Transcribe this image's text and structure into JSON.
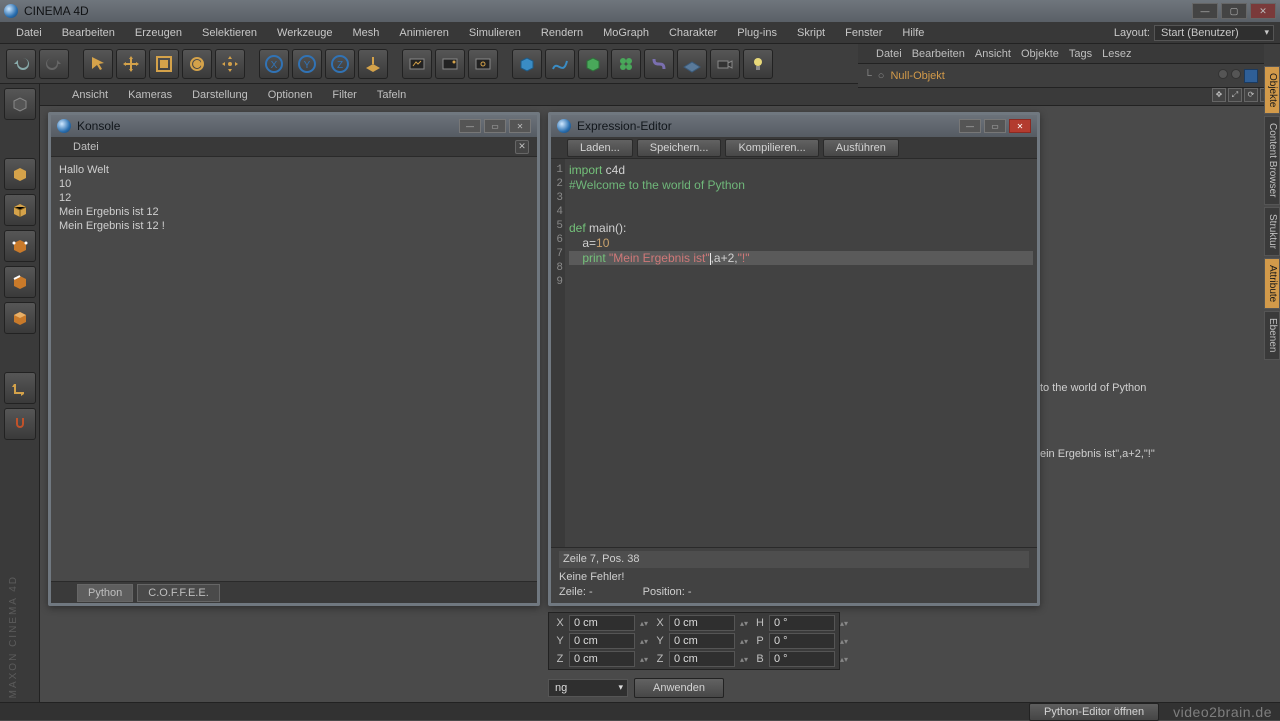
{
  "app": {
    "title": "CINEMA 4D"
  },
  "menubar": [
    "Datei",
    "Bearbeiten",
    "Erzeugen",
    "Selektieren",
    "Werkzeuge",
    "Mesh",
    "Animieren",
    "Simulieren",
    "Rendern",
    "MoGraph",
    "Charakter",
    "Plug-ins",
    "Skript",
    "Fenster",
    "Hilfe"
  ],
  "layout": {
    "label": "Layout:",
    "value": "Start (Benutzer)"
  },
  "viewport_menu": [
    "Ansicht",
    "Kameras",
    "Darstellung",
    "Optionen",
    "Filter",
    "Tafeln"
  ],
  "konsole": {
    "title": "Konsole",
    "menu": "Datei",
    "lines": [
      "Hallo Welt",
      "10",
      "12",
      "Mein Ergebnis ist 12",
      "Mein Ergebnis ist 12 !"
    ],
    "tabs": {
      "python": "Python",
      "coffee": "C.O.F.F.E.E."
    }
  },
  "expr": {
    "title": "Expression-Editor",
    "buttons": {
      "load": "Laden...",
      "save": "Speichern...",
      "compile": "Kompilieren...",
      "run": "Ausführen"
    },
    "code": {
      "l1_kw": "import",
      "l1_rest": " c4d",
      "l2": "#Welcome to the world of Python",
      "l5_kw": "def",
      "l5_rest": " main():",
      "l6_pre": "    a=",
      "l6_num": "10",
      "l7_pre": "    ",
      "l7_kw": "print",
      "l7_sp": " ",
      "l7_str1": "\"Mein Ergebnis ist\"",
      "l7_mid": ",a+2,",
      "l7_str2": "\"!\""
    },
    "gutter": [
      "1",
      "2",
      "3",
      "4",
      "5",
      "6",
      "7",
      "8",
      "9"
    ],
    "status1": "Zeile 7, Pos. 38",
    "status2": "Keine Fehler!",
    "status3a": "Zeile:  -",
    "status3b": "Position:  -"
  },
  "objects": {
    "menu": [
      "Datei",
      "Bearbeiten",
      "Ansicht",
      "Objekte",
      "Tags",
      "Lesez"
    ],
    "item": "Null-Objekt"
  },
  "side_tabs": [
    "Objekte",
    "Content Browser",
    "Struktur",
    "Attribute",
    "Ebenen"
  ],
  "attr": {
    "line1": "to the world of Python",
    "line2": "ein Ergebnis ist\",a+2,\"!\""
  },
  "coord": {
    "x": "0 cm",
    "y": "0 cm",
    "z": "0 cm",
    "x2": "0 cm",
    "y2": "0 cm",
    "z2": "0 cm",
    "h": "0 °",
    "p": "0 °",
    "b": "0 °",
    "dd": "ng",
    "apply": "Anwenden",
    "labels": {
      "X": "X",
      "Y": "Y",
      "Z": "Z",
      "H": "H",
      "P": "P",
      "B": "B"
    }
  },
  "status": {
    "pyedit": "Python-Editor öffnen",
    "wm": "video2brain.de"
  },
  "brand": "MAXON  CINEMA 4D"
}
